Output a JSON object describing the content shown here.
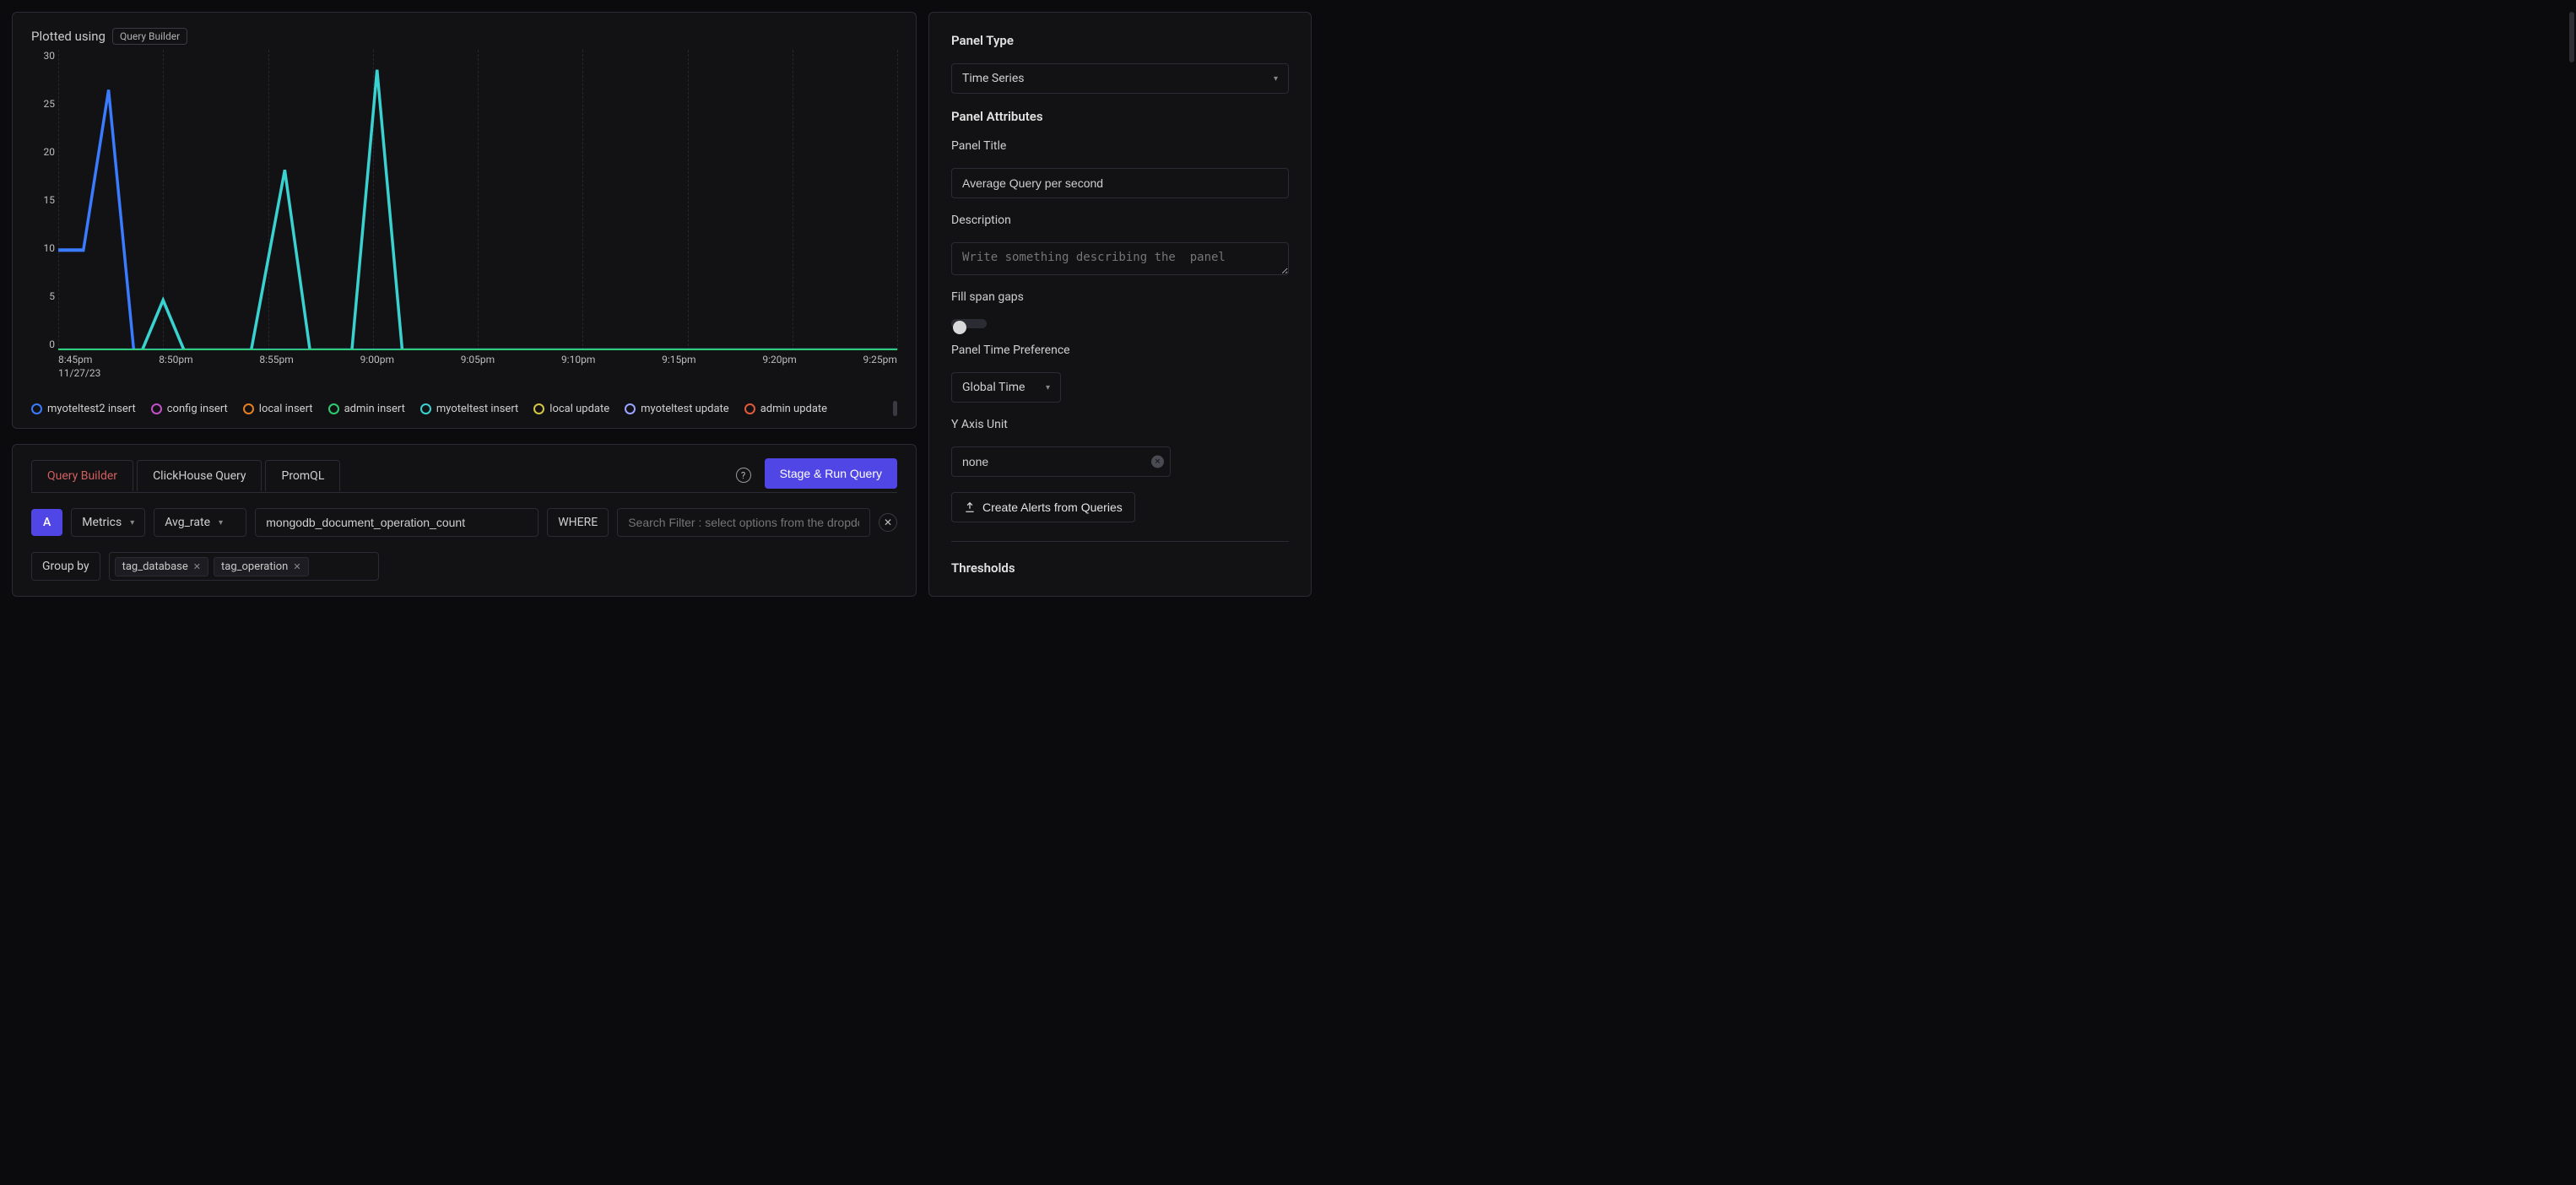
{
  "chart": {
    "plotted_label": "Plotted using",
    "plotted_badge": "Query Builder",
    "y_ticks": [
      "30",
      "25",
      "20",
      "15",
      "10",
      "5",
      "0"
    ],
    "x_ticks": [
      "8:45pm",
      "8:50pm",
      "8:55pm",
      "9:00pm",
      "9:05pm",
      "9:10pm",
      "9:15pm",
      "9:20pm",
      "9:25pm"
    ],
    "x_date": "11/27/23",
    "legend": [
      {
        "label": "myoteltest2 insert",
        "color": "#3a7bff"
      },
      {
        "label": "config insert",
        "color": "#c44fc9"
      },
      {
        "label": "local insert",
        "color": "#e67e22"
      },
      {
        "label": "admin insert",
        "color": "#2ecc71"
      },
      {
        "label": "myoteltest insert",
        "color": "#3ad1d1"
      },
      {
        "label": "local update",
        "color": "#d4c542"
      },
      {
        "label": "myoteltest update",
        "color": "#9aa3ff"
      },
      {
        "label": "admin update",
        "color": "#e05a3a"
      }
    ]
  },
  "query_tabs": {
    "tabs": [
      "Query Builder",
      "ClickHouse Query",
      "PromQL"
    ],
    "run_label": "Stage & Run Query"
  },
  "qb": {
    "badge": "A",
    "source": "Metrics",
    "agg": "Avg_rate",
    "metric": "mongodb_document_operation_count",
    "where": "WHERE",
    "filter_placeholder": "Search Filter : select options from the dropdown",
    "groupby_label": "Group by",
    "tags": [
      "tag_database",
      "tag_operation"
    ]
  },
  "sidebar": {
    "panel_type_label": "Panel Type",
    "panel_type_value": "Time Series",
    "attrs_label": "Panel Attributes",
    "title_label": "Panel Title",
    "title_value": "Average Query per second",
    "desc_label": "Description",
    "desc_placeholder": "Write something describing the  panel",
    "fill_label": "Fill span gaps",
    "time_pref_label": "Panel Time Preference",
    "time_pref_value": "Global Time",
    "yaxis_label": "Y Axis Unit",
    "yaxis_value": "none",
    "create_alerts": "Create Alerts from Queries",
    "thresholds_label": "Thresholds"
  },
  "chart_data": {
    "type": "line",
    "title": "",
    "xlabel": "",
    "ylabel": "",
    "ylim": [
      0,
      30
    ],
    "x": [
      "8:45pm",
      "8:50pm",
      "8:55pm",
      "9:00pm",
      "9:05pm",
      "9:10pm",
      "9:15pm",
      "9:20pm",
      "9:25pm"
    ],
    "series": [
      {
        "name": "myoteltest2 insert",
        "color": "#3a7bff",
        "values": [
          10,
          26,
          0,
          0,
          0,
          0,
          0,
          0,
          0
        ]
      },
      {
        "name": "myoteltest insert",
        "color": "#3ad1d1",
        "values": [
          0,
          5,
          18,
          28,
          0,
          0,
          0,
          0,
          0
        ]
      },
      {
        "name": "config insert",
        "color": "#c44fc9",
        "values": [
          0,
          0,
          0,
          0,
          0,
          0,
          0,
          0,
          0
        ]
      },
      {
        "name": "local insert",
        "color": "#e67e22",
        "values": [
          0,
          0,
          0,
          0,
          0,
          0,
          0,
          0,
          0
        ]
      },
      {
        "name": "admin insert",
        "color": "#2ecc71",
        "values": [
          0,
          0,
          0,
          0,
          0,
          0,
          0,
          0,
          0
        ]
      },
      {
        "name": "local update",
        "color": "#d4c542",
        "values": [
          0,
          0,
          0,
          0,
          0,
          0,
          0,
          0,
          0
        ]
      },
      {
        "name": "myoteltest update",
        "color": "#9aa3ff",
        "values": [
          0,
          0,
          0,
          0,
          0,
          0,
          0,
          0,
          0
        ]
      },
      {
        "name": "admin update",
        "color": "#e05a3a",
        "values": [
          0,
          0,
          0,
          0,
          0,
          0,
          0,
          0,
          0
        ]
      }
    ]
  }
}
